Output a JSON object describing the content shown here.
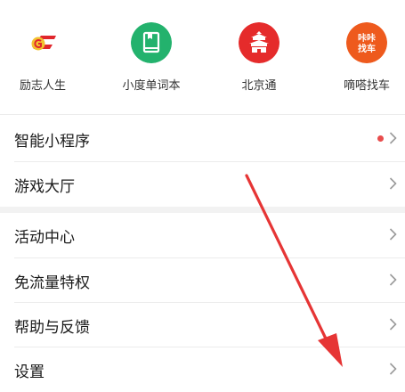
{
  "apps": [
    {
      "label": "励志人生",
      "icon": "lizhi-logo-icon",
      "color": "#ffffff"
    },
    {
      "label": "小度单词本",
      "icon": "book-icon",
      "color": "#23b26d"
    },
    {
      "label": "北京通",
      "icon": "temple-icon",
      "color": "#e52b2b"
    },
    {
      "label": "嘀嗒找车",
      "icon": "didi-car-icon",
      "color": "#ee5a1d",
      "badge_text": "咔咔\n找车"
    }
  ],
  "menu": {
    "mini_programs": "智能小程序",
    "game_hall": "游戏大厅",
    "activity_center": "活动中心",
    "free_data": "免流量特权",
    "help_feedback": "帮助与反馈",
    "settings": "设置"
  },
  "colors": {
    "notification_dot": "#e84c4c",
    "annotation_arrow": "#e63535",
    "chevron": "#9a9a9a"
  }
}
